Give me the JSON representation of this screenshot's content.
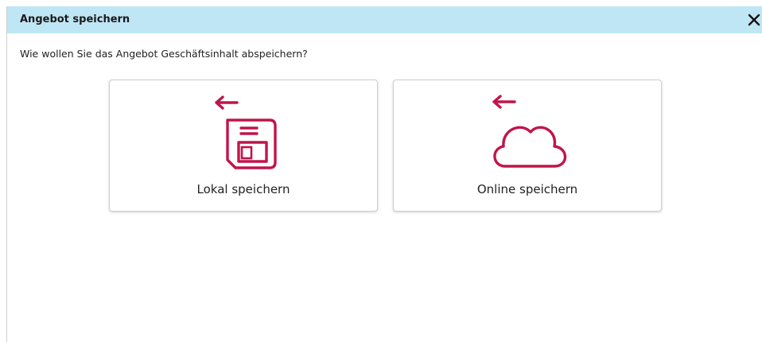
{
  "dialog": {
    "title": "Angebot speichern",
    "close_icon": "close-icon",
    "prompt": "Wie wollen Sie das Angebot Geschäftsinhalt abspeichern?"
  },
  "options": [
    {
      "label": "Lokal speichern",
      "icon": "floppy-disk-icon",
      "arrow_icon": "arrow-left-icon"
    },
    {
      "label": "Online speichern",
      "icon": "cloud-icon",
      "arrow_icon": "arrow-left-icon"
    }
  ],
  "colors": {
    "accent": "#c0154a",
    "titlebar": "#bfe6f5"
  }
}
